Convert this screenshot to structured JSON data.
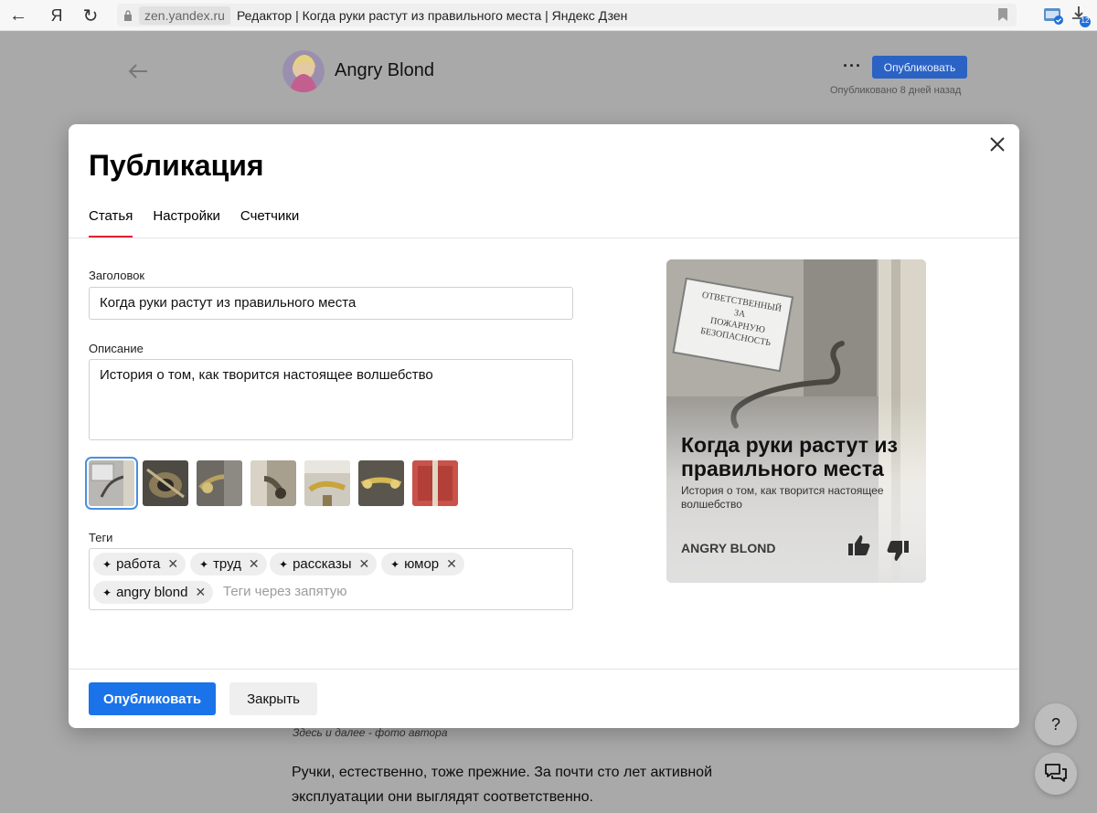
{
  "browser": {
    "back": "←",
    "yandex": "Я",
    "reload": "↻",
    "domain": "zen.yandex.ru",
    "page_title": "Редактор | Когда руки растут из правильного места | Яндекс Дзен",
    "downloads_badge": "12"
  },
  "editor": {
    "author": "Angry Blond",
    "more": "···",
    "publish_label": "Опубликовать",
    "published_ago": "Опубликовано 8 дней назад"
  },
  "article": {
    "caption": "Здесь и далее - фото автора",
    "paragraph": "Ручки, естественно, тоже прежние. За почти сто лет активной эксплуатации они выглядят соответственно."
  },
  "help": {
    "label": "?"
  },
  "modal": {
    "title": "Публикация",
    "tabs": [
      {
        "label": "Статья",
        "active": true
      },
      {
        "label": "Настройки",
        "active": false
      },
      {
        "label": "Счетчики",
        "active": false
      }
    ],
    "heading_label": "Заголовок",
    "heading_value": "Когда руки растут из правильного места",
    "description_label": "Описание",
    "description_value": "История о том, как творится настоящее волшебство",
    "tags_label": "Теги",
    "tags": [
      "работа",
      "труд",
      "рассказы",
      "юмор",
      "angry blond"
    ],
    "tags_placeholder": "Теги через запятую",
    "preview": {
      "title": "Когда руки растут из правильного места",
      "description": "История о том, как творится настоящее волшебство",
      "author": "ANGRY BLOND",
      "sign_text": [
        "ОТВЕТСТВЕННЫЙ",
        "ЗА",
        "ПОЖАРНУЮ",
        "БЕЗОПАСНОСТЬ"
      ]
    },
    "publish_button": "Опубликовать",
    "close_button": "Закрыть"
  },
  "colors": {
    "accent_blue": "#1a73e8",
    "tab_underline": "#e5202e",
    "overlay": "#a9a9a9"
  }
}
